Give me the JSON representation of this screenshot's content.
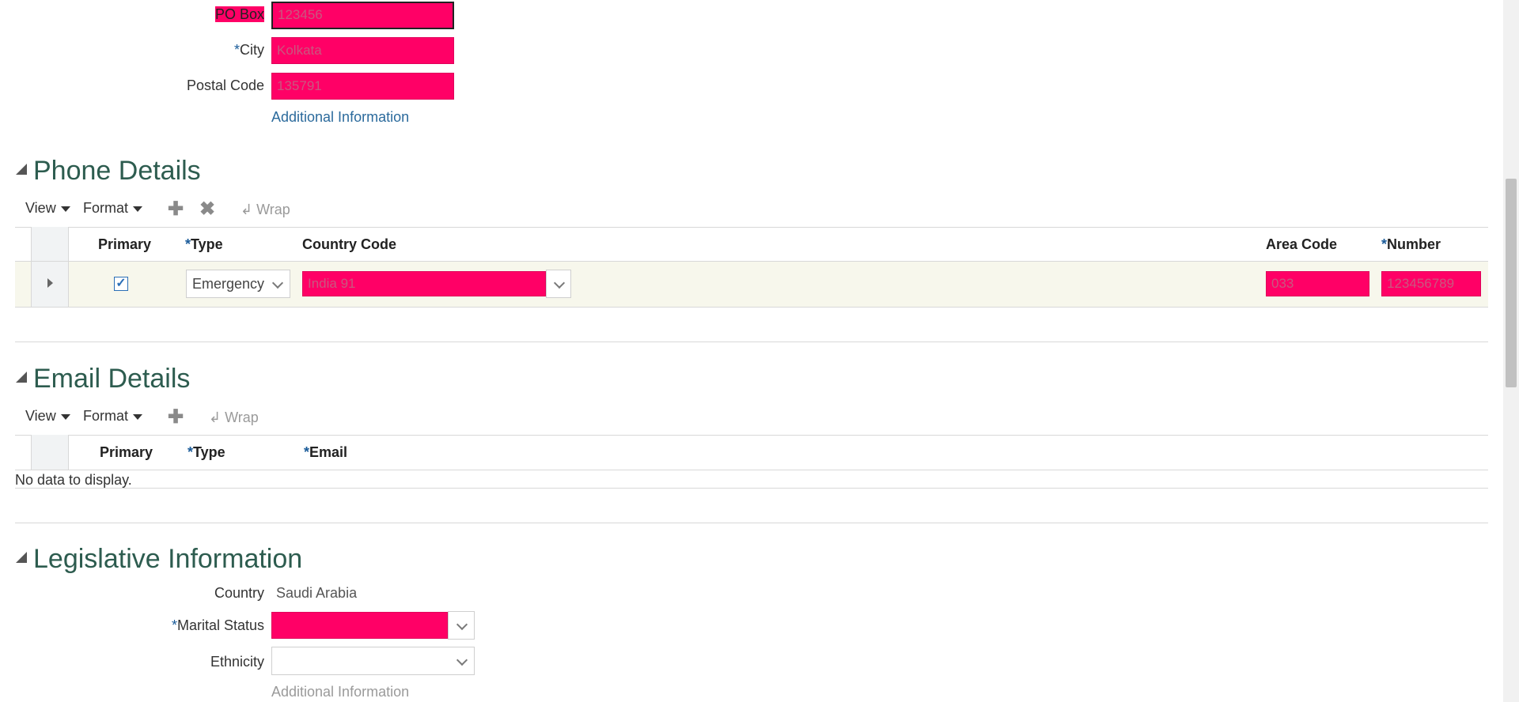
{
  "address": {
    "po_box": {
      "label": "PO Box",
      "value": "123456"
    },
    "city": {
      "required_mark": "*",
      "label": "City",
      "value": "Kolkata"
    },
    "postal_code": {
      "label": "Postal Code",
      "value": "135791"
    },
    "additional_info_link": "Additional Information"
  },
  "phone_details": {
    "title": "Phone Details",
    "toolbar": {
      "view": "View",
      "format": "Format",
      "add_icon": "plus-icon",
      "delete_icon": "close-icon",
      "wrap": "Wrap"
    },
    "columns": {
      "primary": "Primary",
      "type_required": "*",
      "type": "Type",
      "country_code": "Country Code",
      "area_code": "Area Code",
      "number_required": "*",
      "number": "Number"
    },
    "rows": [
      {
        "primary": true,
        "type": "Emergency",
        "country_code": "India 91",
        "area_code": "033",
        "number": "123456789"
      }
    ]
  },
  "email_details": {
    "title": "Email Details",
    "toolbar": {
      "view": "View",
      "format": "Format",
      "add_icon": "plus-icon",
      "wrap": "Wrap"
    },
    "columns": {
      "primary": "Primary",
      "type_required": "*",
      "type": "Type",
      "email_required": "*",
      "email": "Email"
    },
    "empty_message": "No data to display."
  },
  "legislative_information": {
    "title": "Legislative Information",
    "country": {
      "label": "Country",
      "value": "Saudi Arabia"
    },
    "marital_status": {
      "required_mark": "*",
      "label": "Marital Status",
      "value": ""
    },
    "ethnicity": {
      "label": "Ethnicity",
      "value": ""
    },
    "additional_info_link": "Additional Information"
  },
  "colors": {
    "highlight": "#ff0066",
    "section_title": "#2d5c4f",
    "link": "#2b6a9c",
    "required": "#1a5b99",
    "selected_row": "#f7f7ec"
  }
}
